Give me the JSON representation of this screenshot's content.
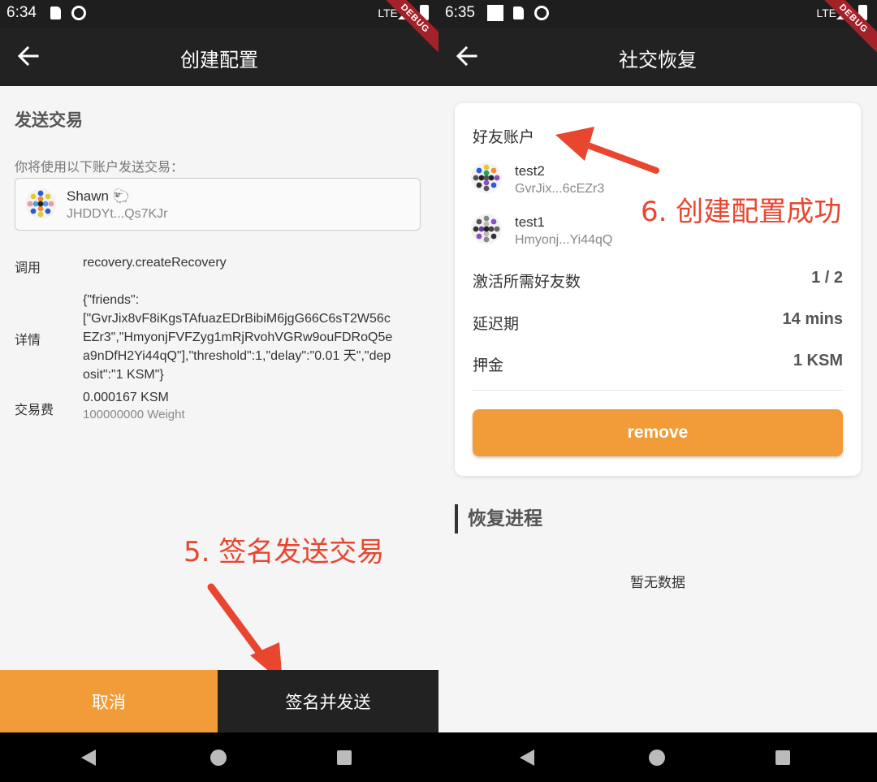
{
  "left": {
    "status": {
      "time": "6:34",
      "network": "LTE"
    },
    "debug": "DEBUG",
    "appbar": {
      "title": "创建配置"
    },
    "section_title": "发送交易",
    "hint": "你将使用以下账户发送交易：",
    "account": {
      "name": "Shawn 🐑",
      "address": "JHDDYt...Qs7KJr"
    },
    "rows": {
      "call_label": "调用",
      "call_value": "recovery.createRecovery",
      "detail_label": "详情",
      "detail_value": "{\"friends\":\n[\"GvrJix8vF8iKgsTAfuazEDrBibiM6jgG66C6sT2W56cEZr3\",\"HmyonjFVFZyg1mRjRvohVGRw9ouFDRoQ5ea9nDfH2Yi44qQ\"],\"threshold\":1,\"delay\":\"0.01 天\",\"deposit\":\"1 KSM\"}",
      "fee_label": "交易费",
      "fee_value": "0.000167 KSM",
      "fee_weight": "100000000 Weight"
    },
    "annotation": "5. 签名发送交易",
    "buttons": {
      "cancel": "取消",
      "sign": "签名并发送"
    }
  },
  "right": {
    "status": {
      "time": "6:35",
      "network": "LTE"
    },
    "debug": "DEBUG",
    "appbar": {
      "title": "社交恢复"
    },
    "card": {
      "title": "好友账户",
      "friends": [
        {
          "name": "test2",
          "address": "GvrJix...6cEZr3"
        },
        {
          "name": "test1",
          "address": "Hmyonj...Yi44qQ"
        }
      ],
      "threshold_label": "激活所需好友数",
      "threshold_value": "1 / 2",
      "delay_label": "延迟期",
      "delay_value": "14 mins",
      "deposit_label": "押金",
      "deposit_value": "1 KSM",
      "remove_label": "remove"
    },
    "annotation": "6. 创建配置成功",
    "progress_title": "恢复进程",
    "empty_text": "暂无数据"
  },
  "colors": {
    "accent": "#f19c38",
    "annotation": "#e8462f",
    "appbar": "#222222"
  }
}
